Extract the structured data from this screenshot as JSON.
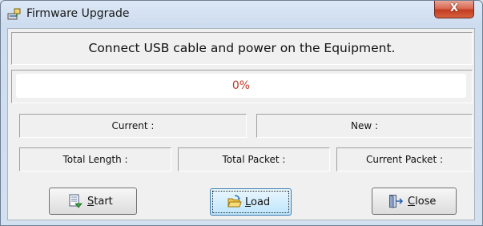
{
  "window": {
    "title": "Firmware Upgrade",
    "close_glyph": "X"
  },
  "message": "Connect USB cable and power on the Equipment.",
  "progress": {
    "fraction": 0,
    "label": "0%",
    "text_color": "#c0392b"
  },
  "info": {
    "current_label": "Current :",
    "new_label": "New :",
    "total_length_label": "Total Length :",
    "total_packet_label": "Total Packet :",
    "current_packet_label": "Current Packet :"
  },
  "buttons": {
    "start": {
      "mnemonic": "S",
      "rest": "tart",
      "icon": "start-document-icon"
    },
    "load": {
      "mnemonic": "L",
      "rest": "oad",
      "icon": "open-folder-icon"
    },
    "close": {
      "mnemonic": "C",
      "rest": "lose",
      "icon": "exit-door-icon"
    }
  }
}
